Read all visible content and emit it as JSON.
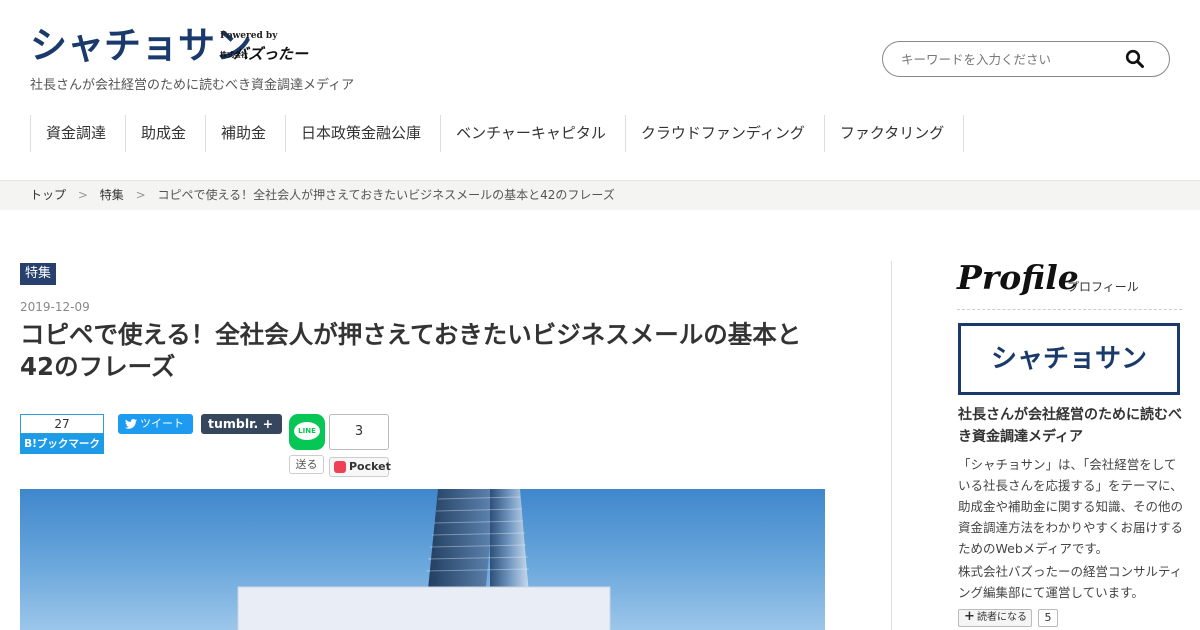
{
  "header": {
    "logo": "シャチョサン",
    "powered_by": "Powered by",
    "company_prefix": "株式会社",
    "company_name": "バズったー",
    "tagline": "社長さんが会社経営のために読むべき資金調達メディア"
  },
  "search": {
    "placeholder": "キーワードを入力ください",
    "icon": "search-icon"
  },
  "nav": {
    "items": [
      {
        "label": "資金調達"
      },
      {
        "label": "助成金"
      },
      {
        "label": "補助金"
      },
      {
        "label": "日本政策金融公庫"
      },
      {
        "label": "ベンチャーキャピタル"
      },
      {
        "label": "クラウドファンディング"
      },
      {
        "label": "ファクタリング"
      }
    ]
  },
  "breadcrumb": {
    "items": [
      {
        "label": "トップ"
      },
      {
        "label": "特集"
      },
      {
        "label": "コピペで使える！全社会人が押さえておきたいビジネスメールの基本と42のフレーズ"
      }
    ],
    "separator": ">"
  },
  "article": {
    "category": "特集",
    "date": "2019-12-09",
    "title": "コピペで使える！全社会人が押さえておきたいビジネスメールの基本と42のフレーズ"
  },
  "share": {
    "hatena_count": "27",
    "hatena_label": "B!ブックマーク",
    "tweet_label": "ツイート",
    "tumblr_label": "tumblr.",
    "tumblr_plus": "+",
    "line_label": "LINE",
    "send_label": "送る",
    "pocket_count": "3",
    "pocket_label": "Pocket"
  },
  "sidebar": {
    "profile_heading": "Profile",
    "profile_sub": "プロフィール",
    "logo": "シャチョサン",
    "tagline": "社長さんが会社経営のために読むべき資金調達メディア",
    "description": "「シャチョサン」は、「会社経営をしている社長さんを応援する」をテーマに、助成金や補助金に関する知識、その他の資金調達方法をわかりやすくお届けするためのWebメディアです。",
    "operator": "株式会社バズったーの経営コンサルティング編集部にて運営しています。",
    "follow_label": "読者になる",
    "follow_count": "5"
  },
  "colors": {
    "brand": "#1a3a6b",
    "badge": "#27406e",
    "hatena": "#1e9be6",
    "twitter": "#1d9bf0",
    "tumblr": "#36465d",
    "line": "#06c755",
    "pocket": "#ef4056"
  }
}
